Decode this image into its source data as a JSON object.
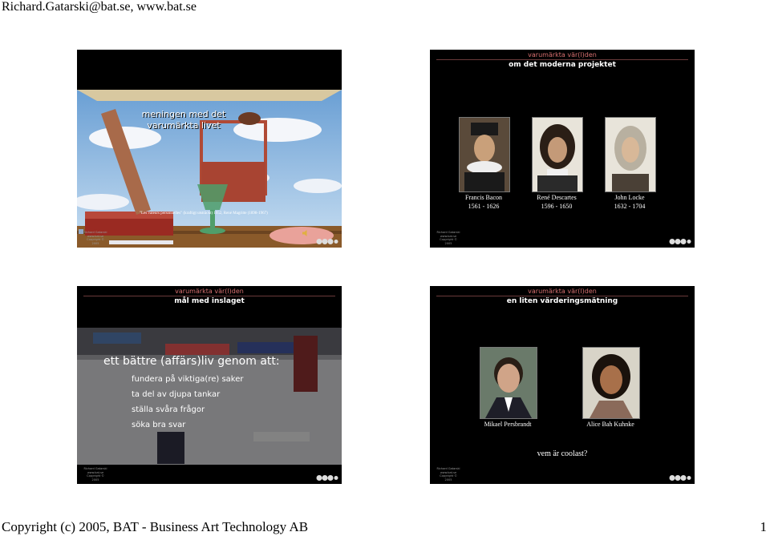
{
  "page": {
    "header": "Richard.Gatarski@bat.se, www.bat.se",
    "footer": "Copyright (c) 2005, BAT - Business Art Technology AB",
    "page_number": "1"
  },
  "slide_footer": [
    "Richard Gatarski",
    "www.bat.se",
    "Copyright © 2005"
  ],
  "slides": [
    {
      "title": "meningen med det varumärkta livet",
      "caption": "\"Les valeurs personnelles\" (kraftigt utsträckt) 1952, René Magritte (1898-1967)"
    },
    {
      "kicker": "varumärkta vär(l)den",
      "subtitle": "om det moderna projektet",
      "people": [
        {
          "name": "Francis Bacon",
          "years": "1561 - 1626"
        },
        {
          "name": "René Descartes",
          "years": "1596 - 1650"
        },
        {
          "name": "John Locke",
          "years": "1632 - 1704"
        }
      ]
    },
    {
      "kicker": "varumärkta vär(l)den",
      "subtitle": "mål med inslaget",
      "lead": "ett bättre (affärs)liv genom att:",
      "items": [
        "fundera på viktiga(re) saker",
        "ta del av djupa tankar",
        "ställa svåra frågor",
        "söka bra svar"
      ]
    },
    {
      "kicker": "varumärkta vär(l)den",
      "subtitle": "en liten värderingsmätning",
      "people": [
        "Mikael Persbrandt",
        "Alice Bah Kuhnke"
      ],
      "question": "vem är coolast?"
    }
  ],
  "icons": [
    "speaker-icon",
    "bat-logo"
  ],
  "colors": {
    "slide_bg": "#000000",
    "kicker": "#d87070",
    "text": "#ffffff"
  }
}
